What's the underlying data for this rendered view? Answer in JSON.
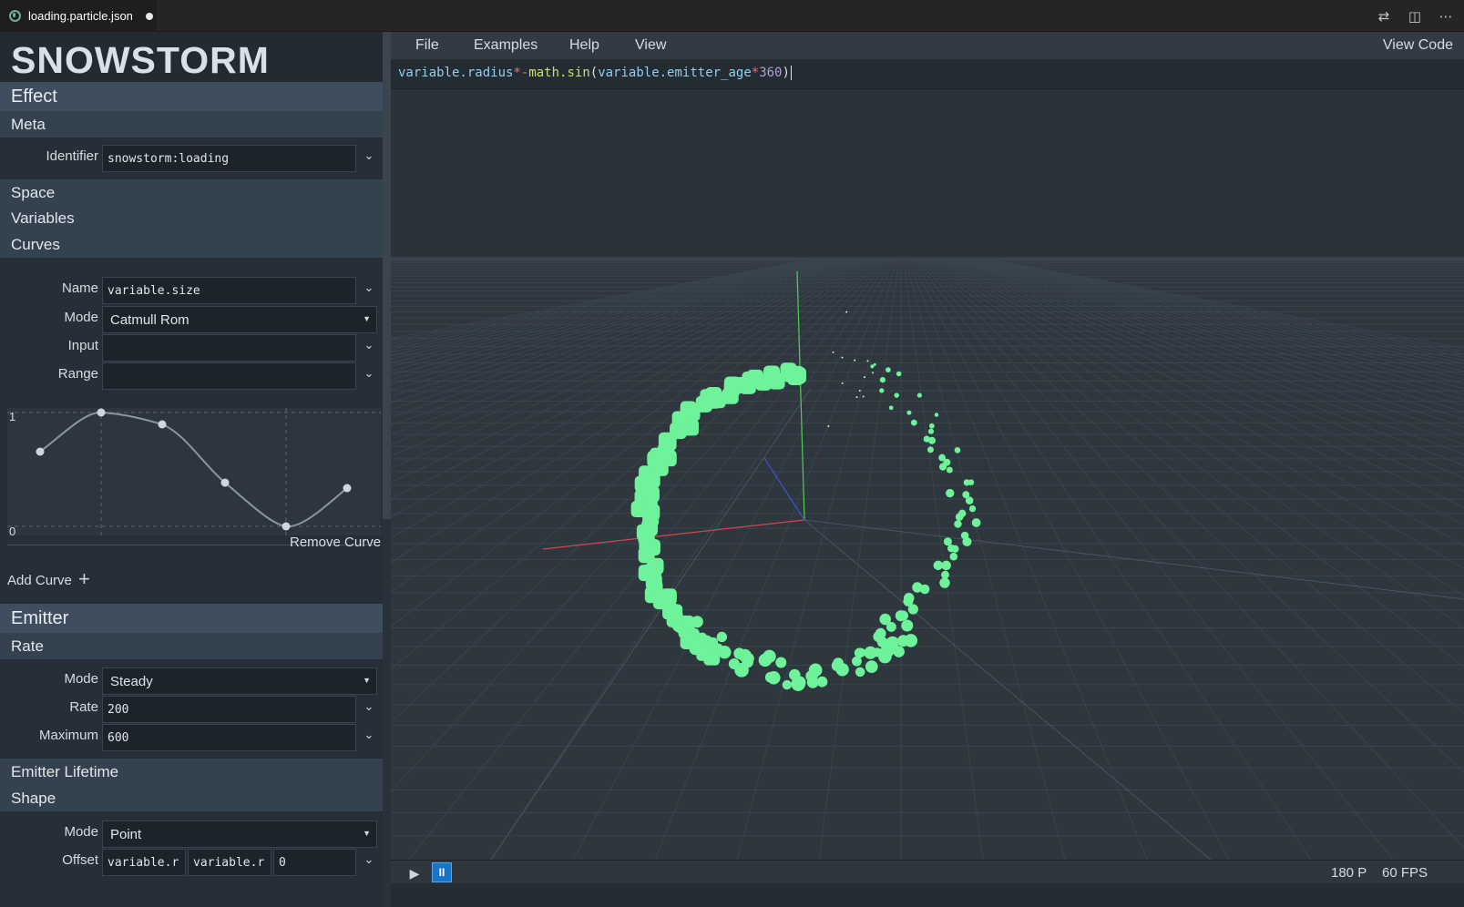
{
  "tab": {
    "filename": "loading.particle.json",
    "icons": [
      "file-json-icon",
      "unsaved-dot-icon"
    ],
    "actions": [
      {
        "name": "compare-changes-icon",
        "glyph": "⇄"
      },
      {
        "name": "split-editor-icon",
        "glyph": "◫"
      },
      {
        "name": "more-actions-icon",
        "glyph": "⋯"
      }
    ]
  },
  "sidebar": {
    "logo": "SNOWSTORM",
    "effect": {
      "title": "Effect",
      "meta": {
        "title": "Meta",
        "identifier_label": "Identifier",
        "identifier_value": "snowstorm:loading"
      },
      "space_title": "Space",
      "variables_title": "Variables",
      "curves": {
        "title": "Curves",
        "name_label": "Name",
        "name_value": "variable.size",
        "mode_label": "Mode",
        "mode_value": "Catmull Rom",
        "input_label": "Input",
        "input_value": "",
        "range_label": "Range",
        "range_value": "",
        "graph_max": "1",
        "graph_min": "0",
        "remove_label": "Remove Curve",
        "add_label": "Add Curve"
      }
    },
    "emitter": {
      "title": "Emitter",
      "rate": {
        "title": "Rate",
        "mode_label": "Mode",
        "mode_value": "Steady",
        "rate_label": "Rate",
        "rate_value": "200",
        "max_label": "Maximum",
        "max_value": "600"
      },
      "lifetime_title": "Emitter Lifetime",
      "shape": {
        "title": "Shape",
        "mode_label": "Mode",
        "mode_value": "Point",
        "offset_label": "Offset",
        "offset_values": [
          "variable.r",
          "variable.r",
          "0"
        ]
      }
    }
  },
  "menu": {
    "items": [
      "File",
      "Examples",
      "Help",
      "View"
    ],
    "view_code": "View Code"
  },
  "expression": {
    "tokens": [
      {
        "t": "variable.radius",
        "c": "tk-var"
      },
      {
        "t": "*",
        "c": "tk-op"
      },
      {
        "t": "-",
        "c": "tk-op"
      },
      {
        "t": "math.sin",
        "c": "tk-fn"
      },
      {
        "t": "(",
        "c": "tk-p"
      },
      {
        "t": "variable.emitter_age",
        "c": "tk-var"
      },
      {
        "t": "*",
        "c": "tk-op"
      },
      {
        "t": "360",
        "c": "tk-num"
      },
      {
        "t": ")",
        "c": "tk-p"
      }
    ]
  },
  "status": {
    "particles": "180 P",
    "fps": "60 FPS",
    "play_glyph": "▶",
    "pause_glyph": "II"
  },
  "colors": {
    "particle": "#6ef29a",
    "axis_x": "#d8434d",
    "axis_y": "#4fd05a",
    "axis_z": "#3a57c8",
    "accent": "#1874c9"
  }
}
